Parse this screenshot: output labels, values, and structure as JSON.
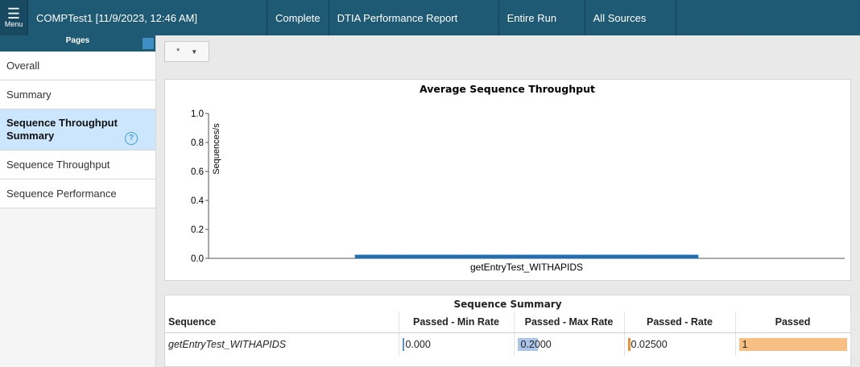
{
  "topbar": {
    "menu_label": "Menu",
    "tabs": [
      "COMPTest1 [11/9/2023, 12:46 AM]",
      "Complete",
      "DTIA Performance Report",
      "Entire Run",
      "All Sources"
    ]
  },
  "sidebar": {
    "header": "Pages",
    "items": [
      {
        "label": "Overall"
      },
      {
        "label": "Summary"
      },
      {
        "label": "Sequence Throughput Summary",
        "active": true
      },
      {
        "label": "Sequence Throughput"
      },
      {
        "label": "Sequence Performance"
      }
    ],
    "help_glyph": "?"
  },
  "toolbar": {
    "dropdown_value": "*"
  },
  "chart_data": {
    "type": "bar",
    "title": "Average Sequence Throughput",
    "ylabel": "Sequences/s",
    "xlabel": "",
    "categories": [
      "getEntryTest_WITHAPIDS"
    ],
    "values": [
      0.025
    ],
    "ylim": [
      0,
      1.0
    ],
    "yticks": [
      "0.0",
      "0.2",
      "0.4",
      "0.6",
      "0.8",
      "1.0"
    ],
    "bar_color": "#1f6fb5",
    "grid": false
  },
  "summary": {
    "title": "Sequence Summary",
    "columns": [
      "Sequence",
      "Passed - Min Rate",
      "Passed - Max Rate",
      "Passed - Rate",
      "Passed"
    ],
    "rows": [
      {
        "sequence": "getEntryTest_WITHAPIDS",
        "min_rate": "0.000",
        "max_rate": "0.2000",
        "rate": "0.02500",
        "passed": "1",
        "min_rate_fraction": 0.0,
        "max_rate_fraction": 0.2,
        "rate_fraction": 0.025,
        "passed_fraction": 1.0,
        "min_rate_color": "#5b8fd6",
        "max_rate_color": "#aac4ea",
        "rate_color": "#f0902a",
        "passed_color": "#f8bf85"
      }
    ]
  }
}
